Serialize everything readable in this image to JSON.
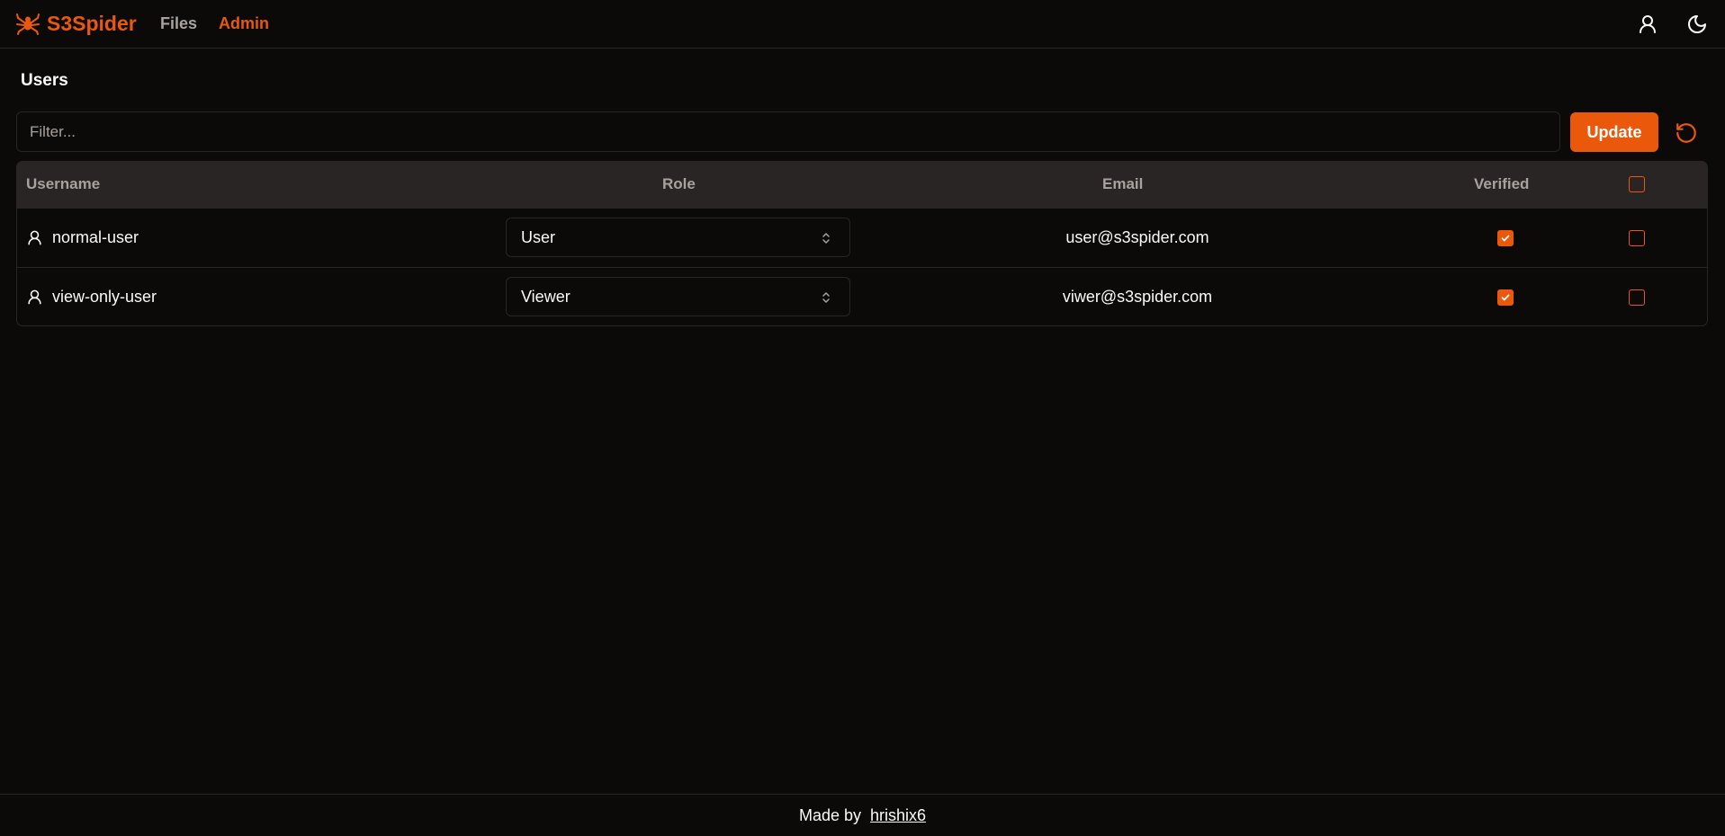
{
  "app": {
    "name": "S3Spider",
    "accent": "#ea580c"
  },
  "nav": {
    "links": [
      {
        "label": "Files",
        "active": false
      },
      {
        "label": "Admin",
        "active": true
      }
    ],
    "icons": [
      "user-icon",
      "moon-icon"
    ]
  },
  "page": {
    "title": "Users"
  },
  "filter": {
    "placeholder": "Filter...",
    "value": ""
  },
  "actions": {
    "update_label": "Update",
    "refresh_icon": "refresh-icon"
  },
  "table": {
    "headers": {
      "username": "Username",
      "role": "Role",
      "email": "Email",
      "verified": "Verified"
    },
    "select_all_checked": false,
    "rows": [
      {
        "username": "normal-user",
        "role": "User",
        "email": "user@s3spider.com",
        "verified": true,
        "selected": false
      },
      {
        "username": "view-only-user",
        "role": "Viewer",
        "email": "viwer@s3spider.com",
        "verified": true,
        "selected": false
      }
    ]
  },
  "footer": {
    "prefix": "Made by",
    "author": "hrishix6"
  }
}
